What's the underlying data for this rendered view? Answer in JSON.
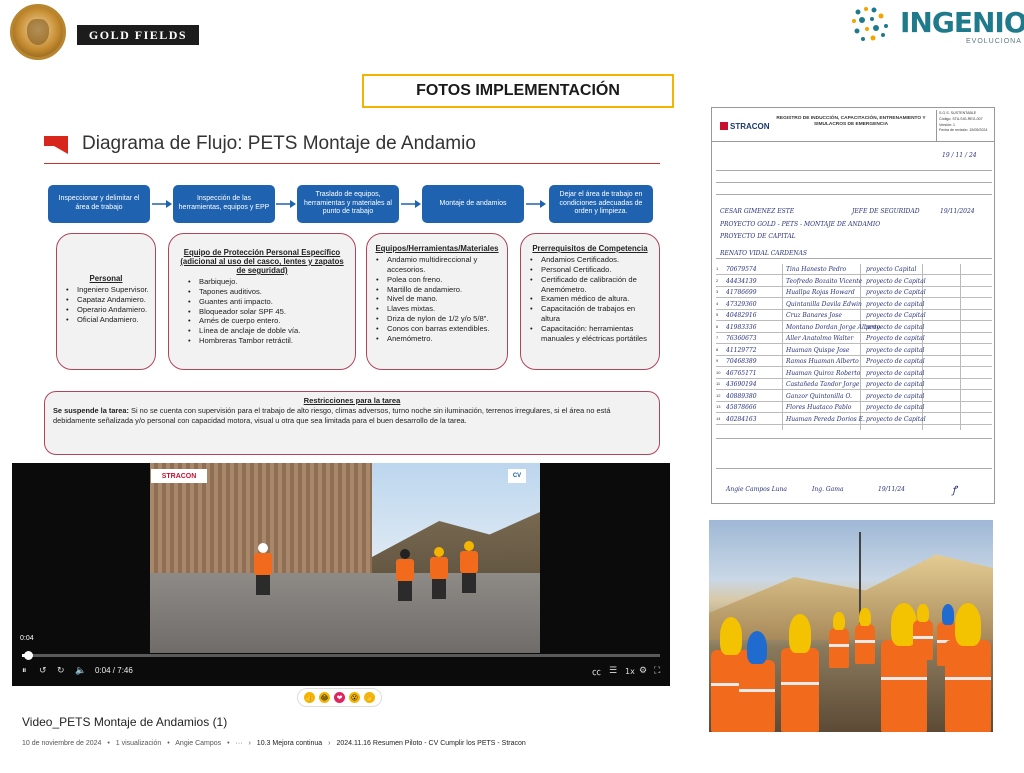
{
  "header": {
    "gold_fields_logo": "GOLD FIELDS",
    "ingenio_logo": "INGENIO",
    "ingenio_tagline": "EVOLUCIONA",
    "page_title": "FOTOS IMPLEMENTACIÓN"
  },
  "diagram": {
    "title": "Diagrama de Flujo: PETS Montaje de Andamio",
    "steps": [
      "Inspeccionar y delimitar el área de trabajo",
      "Inspección de las herramientas, equipos y EPP",
      "Traslado de equipos, herramientas y materiales al punto de trabajo",
      "Montaje de andamios",
      "Dejar el área de trabajo en condiciones adecuadas de orden y limpieza."
    ],
    "cards": [
      {
        "heading": "Personal",
        "items": [
          "Ingeniero Supervisor.",
          "Capataz Andamiero.",
          "Operario Andamiero.",
          "Oficial Andamiero."
        ]
      },
      {
        "heading": "Equipo de Protección Personal Específico (adicional al uso del casco, lentes y zapatos de seguridad)",
        "items": [
          "Barbiquejo.",
          "Tapones auditivos.",
          "Guantes anti impacto.",
          "Bloqueador solar SPF 45.",
          "Arnés de cuerpo entero.",
          "Línea de anclaje de doble vía.",
          "Hombreras Tambor retráctil."
        ]
      },
      {
        "heading": "Equipos/Herramientas/Materiales",
        "items": [
          "Andamio multidireccional y accesorios.",
          "Polea con freno.",
          "Martillo de andamiero.",
          "Nivel de mano.",
          "Llaves mixtas.",
          "Driza de nylon de 1/2 y/o 5/8\".",
          "Conos con barras extendibles.",
          "Anemómetro."
        ]
      },
      {
        "heading": "Prerrequisitos de Competencia",
        "items": [
          "Andamios Certificados.",
          "Personal Certificado.",
          "Certificado de calibración de Anemómetro.",
          "Examen médico de altura.",
          "Capacitación de trabajos en altura",
          "Capacitación: herramientas manuales y eléctricas portátiles"
        ]
      }
    ],
    "restrictions": {
      "heading": "Restricciones para la tarea",
      "lead": "Se suspende la tarea:",
      "text": " Si no se cuenta con supervisión para el trabajo de alto riesgo, climas adversos, turno noche sin iluminación, terrenos irregulares, si el área no está debidamente señalizada y/o personal con capacidad motora, visual u otra que sea limitada para el buen desarrollo de la tarea."
    }
  },
  "video": {
    "stracon_label": "STRACON",
    "cv_label": "CV",
    "hover_time": "0:04",
    "time_display": "0:04 / 7:46",
    "progress": 0.009,
    "speed_label": "1x",
    "title": "Video_PETS Montaje de Andamios (1)",
    "meta_date": "10 de noviembre de 2024",
    "meta_views": "1 visualización",
    "meta_author": "Angie Campos",
    "meta_ellipsis": "···",
    "breadcrumbs": [
      "10.3 Mejora continua",
      "2024.11.16 Resumen Piloto - CV Cumplir los PETS - Stracon"
    ],
    "reactions": [
      {
        "icon": "thumbs-up-icon",
        "glyph": "👍",
        "color": "#f3b500"
      },
      {
        "icon": "laugh-icon",
        "glyph": "😂",
        "color": "#f3b500"
      },
      {
        "icon": "heart-icon",
        "glyph": "❤",
        "color": "#e0245e"
      },
      {
        "icon": "wow-icon",
        "glyph": "😮",
        "color": "#f3b500"
      },
      {
        "icon": "clap-icon",
        "glyph": "👏",
        "color": "#f3b500"
      }
    ]
  },
  "form": {
    "logo": "STRACON",
    "title": "REGISTRO DE INDUCCIÓN, CAPACITACIÓN, ENTRENAMIENTO Y SIMULACROS DE EMERGENCIA",
    "code_lines": [
      "S.G.S. SUSTENTABLE",
      "Código: STA-SIG-REG-007",
      "Versión: 1",
      "Fecha de revisión: 15/05/2024"
    ],
    "handwritten_date": "19 / 11 / 24",
    "handwritten_fields": [
      "CESAR GIMENEZ ESTE",
      "JEFE DE SEGURIDAD",
      "19/11/2024",
      "PROYECTO GOLD - PETS - MONTAJE DE ANDAMIO",
      "PROYECTO DE CAPITAL",
      "RENATO VIDAL CARDENAS"
    ],
    "rows": [
      {
        "num": "1",
        "dni": "70679574",
        "name": "Tina Hanesto Pedro",
        "area": "proyecto Capital"
      },
      {
        "num": "2",
        "dni": "44434139",
        "name": "Teofredo Bozaito Vicente",
        "area": "proyecto de Capital"
      },
      {
        "num": "3",
        "dni": "41786699",
        "name": "Huallpa Rojas Howard",
        "area": "proyecto de Capital"
      },
      {
        "num": "4",
        "dni": "47329360",
        "name": "Quintanilla Davila Edwin",
        "area": "proyecto de capital"
      },
      {
        "num": "5",
        "dni": "40482916",
        "name": "Cruz Banares Jose",
        "area": "proyecto de Capital"
      },
      {
        "num": "6",
        "dni": "41983336",
        "name": "Montano Dordan Jorge Alberto",
        "area": "proyecto de capital"
      },
      {
        "num": "7",
        "dni": "76360673",
        "name": "Aller Anatolmo Walter",
        "area": "Proyecto de capital"
      },
      {
        "num": "8",
        "dni": "41129772",
        "name": "Huaman Quispe Jose",
        "area": "proyecto de capital"
      },
      {
        "num": "9",
        "dni": "70468389",
        "name": "Ramos Huaman Alberto",
        "area": "Proyecto de capital"
      },
      {
        "num": "10",
        "dni": "46765171",
        "name": "Huaman Quiroz Roberto",
        "area": "proyecto de capital"
      },
      {
        "num": "11",
        "dni": "43690194",
        "name": "Castañeda Tandor Jorge",
        "area": "proyecto de capital"
      },
      {
        "num": "12",
        "dni": "40889380",
        "name": "Ganzor Quintonilla O.",
        "area": "proyecto de capital"
      },
      {
        "num": "13",
        "dni": "45878666",
        "name": "Flores Huataco Pablo",
        "area": "proyecto de capital"
      },
      {
        "num": "14",
        "dni": "40284163",
        "name": "Huaman Pereda Dorios E.",
        "area": "proyecto de Capital"
      }
    ],
    "footer_name": "Angie Campos Luna",
    "footer_role": "Ing. Gama",
    "footer_date": "19/11/24"
  }
}
